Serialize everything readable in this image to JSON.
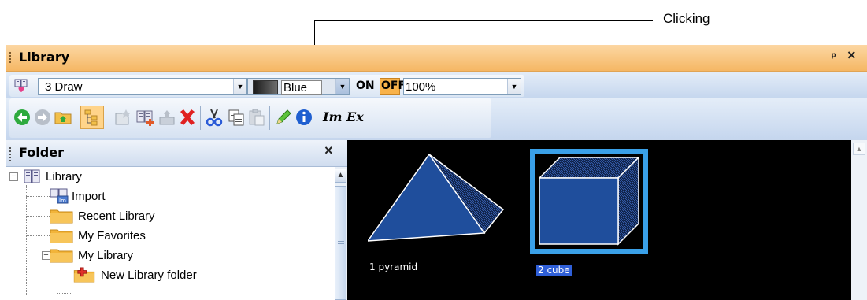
{
  "annotation": {
    "callout_label": "Clicking"
  },
  "window": {
    "title": "Library",
    "pin_icon": "pin-icon",
    "close_icon": "close-icon"
  },
  "toolbar1": {
    "library_combo": "3 Draw",
    "color_combo": "Blue",
    "on_label": "ON",
    "off_label": "OFF",
    "zoom_combo": "100%"
  },
  "toolbar2": {
    "icons": [
      "back-icon",
      "forward-icon",
      "up-folder-icon",
      "folder-tree-toggle-icon",
      "new-folder-icon",
      "new-library-icon",
      "import-icon",
      "delete-icon",
      "cut-icon",
      "copy-icon",
      "paste-icon",
      "edit-icon",
      "properties-icon",
      "import-file-icon",
      "export-file-icon"
    ],
    "im_label": "Im",
    "ex_label": "Ex"
  },
  "folder_panel": {
    "title": "Folder",
    "items": [
      {
        "label": "Library",
        "expander": "−"
      },
      {
        "label": "Import"
      },
      {
        "label": "Recent Library"
      },
      {
        "label": "My Favorites"
      },
      {
        "label": "My Library",
        "expander": "−"
      },
      {
        "label": "New Library folder"
      }
    ]
  },
  "thumbnails": {
    "items": [
      {
        "label": "1 pyramid",
        "selected": false
      },
      {
        "label": "2 cube",
        "selected": true
      }
    ],
    "selection_color": "#3aa0e8",
    "shape_color": "#1f4e9c"
  }
}
